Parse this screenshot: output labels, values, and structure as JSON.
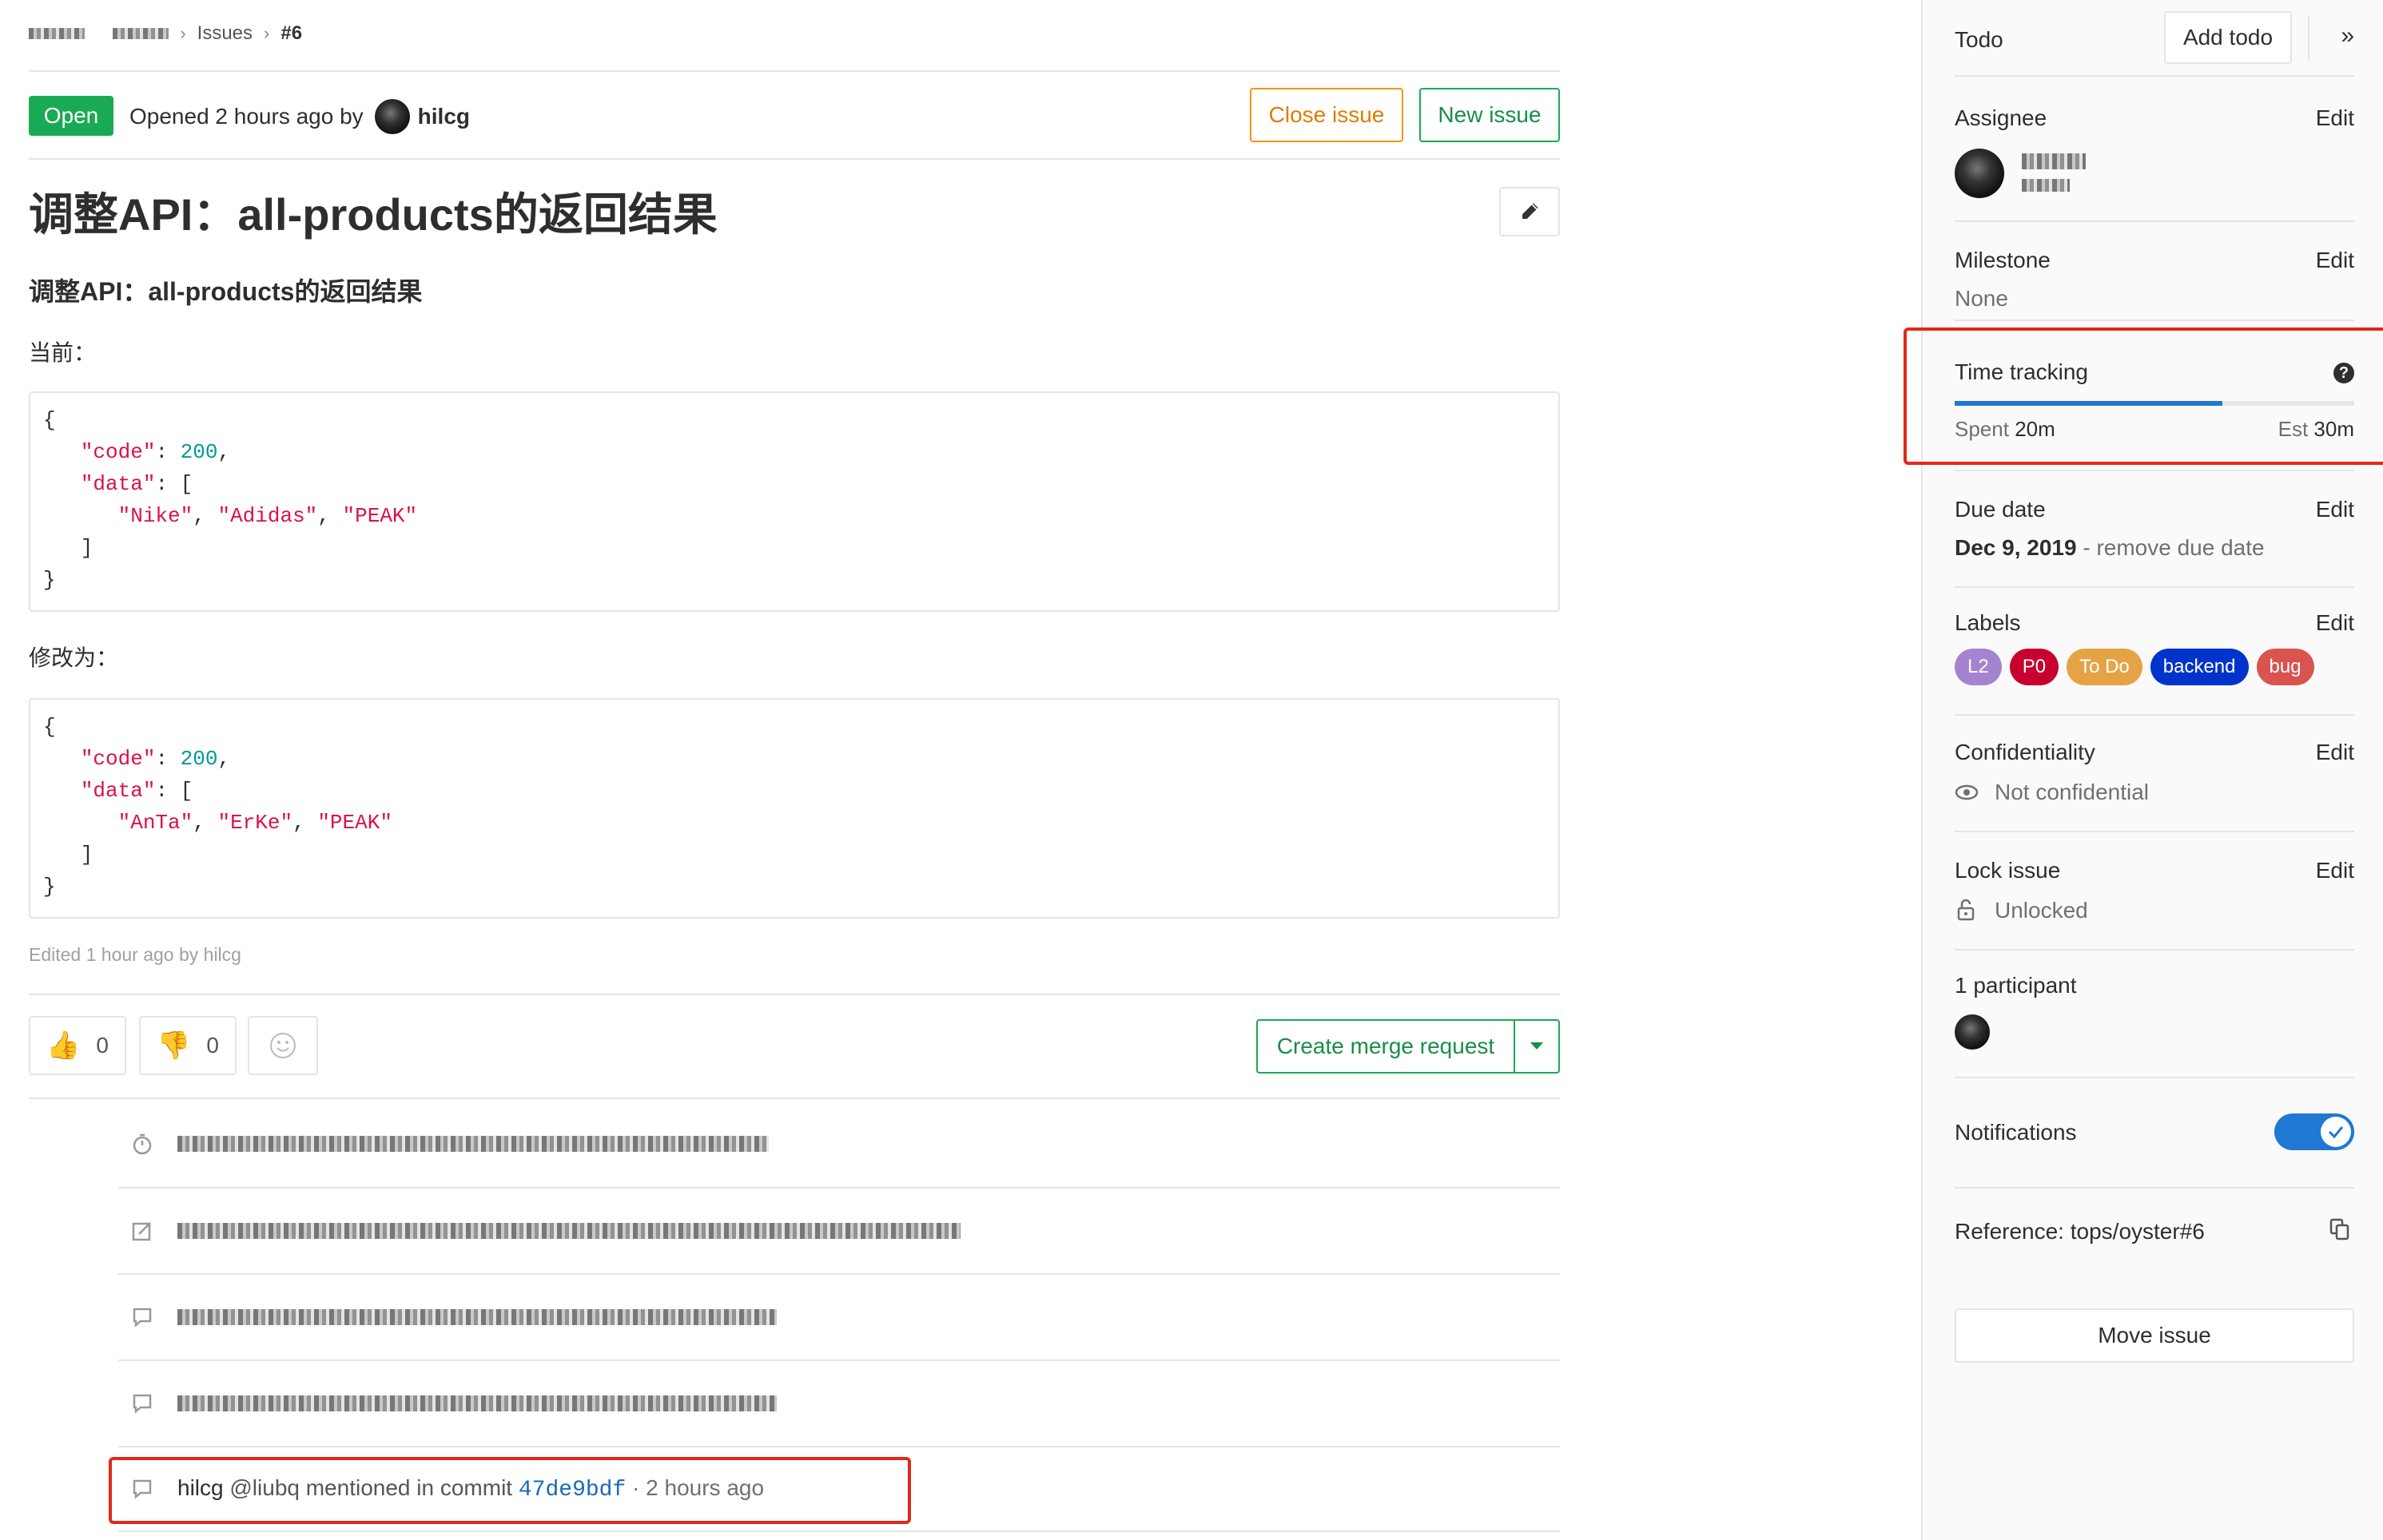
{
  "breadcrumb": {
    "issues": "Issues",
    "current": "#6"
  },
  "issue": {
    "status": "Open",
    "opened_prefix": "Opened 2 hours ago by",
    "author": "hilcg",
    "title": "调整API：all-products的返回结果",
    "subtitle": "调整API：all-products的返回结果",
    "current_label": "当前：",
    "change_label": "修改为：",
    "code_before": {
      "code_key": "\"code\"",
      "code_val": "200",
      "data_key": "\"data\"",
      "items": [
        "\"Nike\"",
        "\"Adidas\"",
        "\"PEAK\""
      ]
    },
    "code_after": {
      "code_key": "\"code\"",
      "code_val": "200",
      "data_key": "\"data\"",
      "items": [
        "\"AnTa\"",
        "\"ErKe\"",
        "\"PEAK\""
      ]
    },
    "edited": "Edited 1 hour ago by hilcg"
  },
  "actions": {
    "close": "Close issue",
    "new": "New issue",
    "create_mr": "Create merge request"
  },
  "awards": {
    "thumbs_up": "0",
    "thumbs_down": "0"
  },
  "activity_last": {
    "user": "hilcg",
    "text": "@liubq mentioned in commit",
    "commit": "47de9bdf",
    "time": "· 2 hours ago"
  },
  "sidebar": {
    "todo_label": "Todo",
    "add_todo": "Add todo",
    "assignee_label": "Assignee",
    "edit": "Edit",
    "milestone_label": "Milestone",
    "milestone_value": "None",
    "time_tracking_label": "Time tracking",
    "spent_label": "Spent",
    "spent_value": "20m",
    "est_label": "Est",
    "est_value": "30m",
    "time_progress": 0.67,
    "due_label": "Due date",
    "due_value": "Dec 9, 2019",
    "remove_due": "- remove due date",
    "labels_label": "Labels",
    "labels": [
      {
        "text": "L2",
        "color": "#a484d1"
      },
      {
        "text": "P0",
        "color": "#c7002f"
      },
      {
        "text": "To Do",
        "color": "#e6a345"
      },
      {
        "text": "backend",
        "color": "#0033cc"
      },
      {
        "text": "bug",
        "color": "#d9534f"
      }
    ],
    "confidentiality_label": "Confidentiality",
    "confidentiality_value": "Not confidential",
    "lock_label": "Lock issue",
    "lock_value": "Unlocked",
    "participants_label": "1 participant",
    "notifications_label": "Notifications",
    "notifications_on": true,
    "reference_label": "Reference: tops/oyster#6",
    "move_issue": "Move issue"
  }
}
